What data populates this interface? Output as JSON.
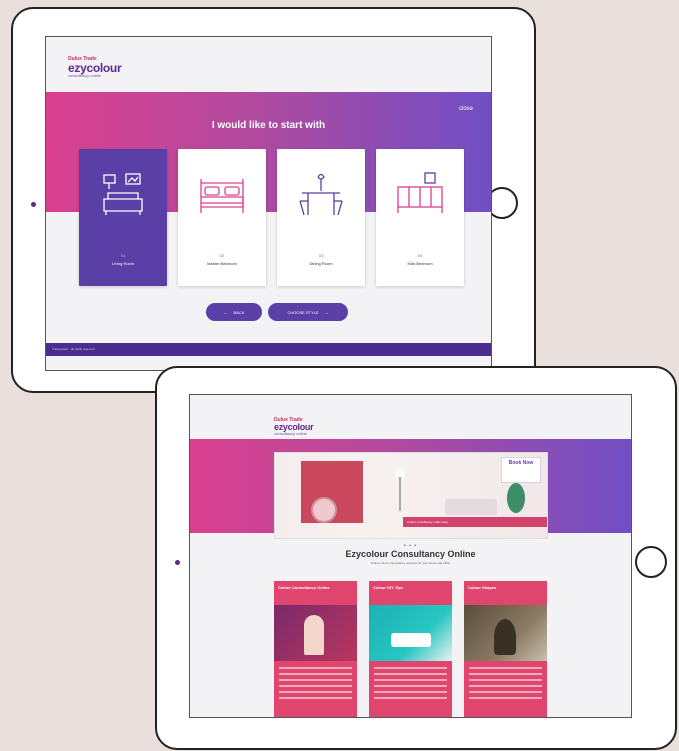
{
  "top_screen": {
    "logo": {
      "tagline": "Dulux Trade",
      "brand": "ezycolour",
      "subtitle": "consultancy online"
    },
    "heading": "I would like to start with",
    "close_label": "close",
    "rooms": [
      {
        "label": "Living Room",
        "number": "01",
        "active": true
      },
      {
        "label": "Master Bedroom",
        "number": "02",
        "active": false
      },
      {
        "label": "Dining Room",
        "number": "03",
        "active": false
      },
      {
        "label": "Kids Bedroom",
        "number": "04",
        "active": false
      }
    ],
    "back_label": "BACK",
    "next_label": "CHOOSE STYLE",
    "footer_text": "© Ezycolour · all rights reserved"
  },
  "bottom_screen": {
    "logo": {
      "tagline": "Dulux Trade",
      "brand": "ezycolour",
      "subtitle": "consultancy online"
    },
    "banner_badge": "Book Now",
    "banner_strip": "Colour consultancy made easy",
    "carousel_dots": "• • •",
    "heading": "Ezycolour Consultancy Online",
    "subheading": "Online colour consultancy services for your home and office",
    "services": [
      {
        "title": "Colour Consultancy Online"
      },
      {
        "title": "Colour DIY Tips"
      },
      {
        "title": "Colour Shapes"
      }
    ]
  },
  "colors": {
    "primary_purple": "#5a3fa6",
    "magenta": "#d9408e",
    "violet": "#6f4fc4",
    "card_pink": "#e0456e"
  }
}
